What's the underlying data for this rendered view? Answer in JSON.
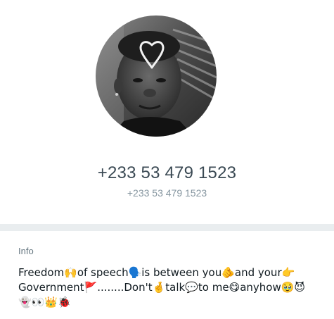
{
  "profile": {
    "phone_primary": "+233 53 479 1523",
    "phone_secondary": "+233 53 479 1523"
  },
  "info": {
    "label": "Info",
    "about_text": "Freedom🙌of speech🗣️is between you🫵and your👉Government🚩........Don't🤞talk💬to me😋anyhow🥹😈\n👻👀👑🐞"
  },
  "colors": {
    "primary_text": "#3b4a54",
    "secondary_text": "#8696a0",
    "divider": "#e9edef",
    "label": "#667781"
  },
  "icons": {
    "avatar_overlay": "heart-outline-icon"
  }
}
